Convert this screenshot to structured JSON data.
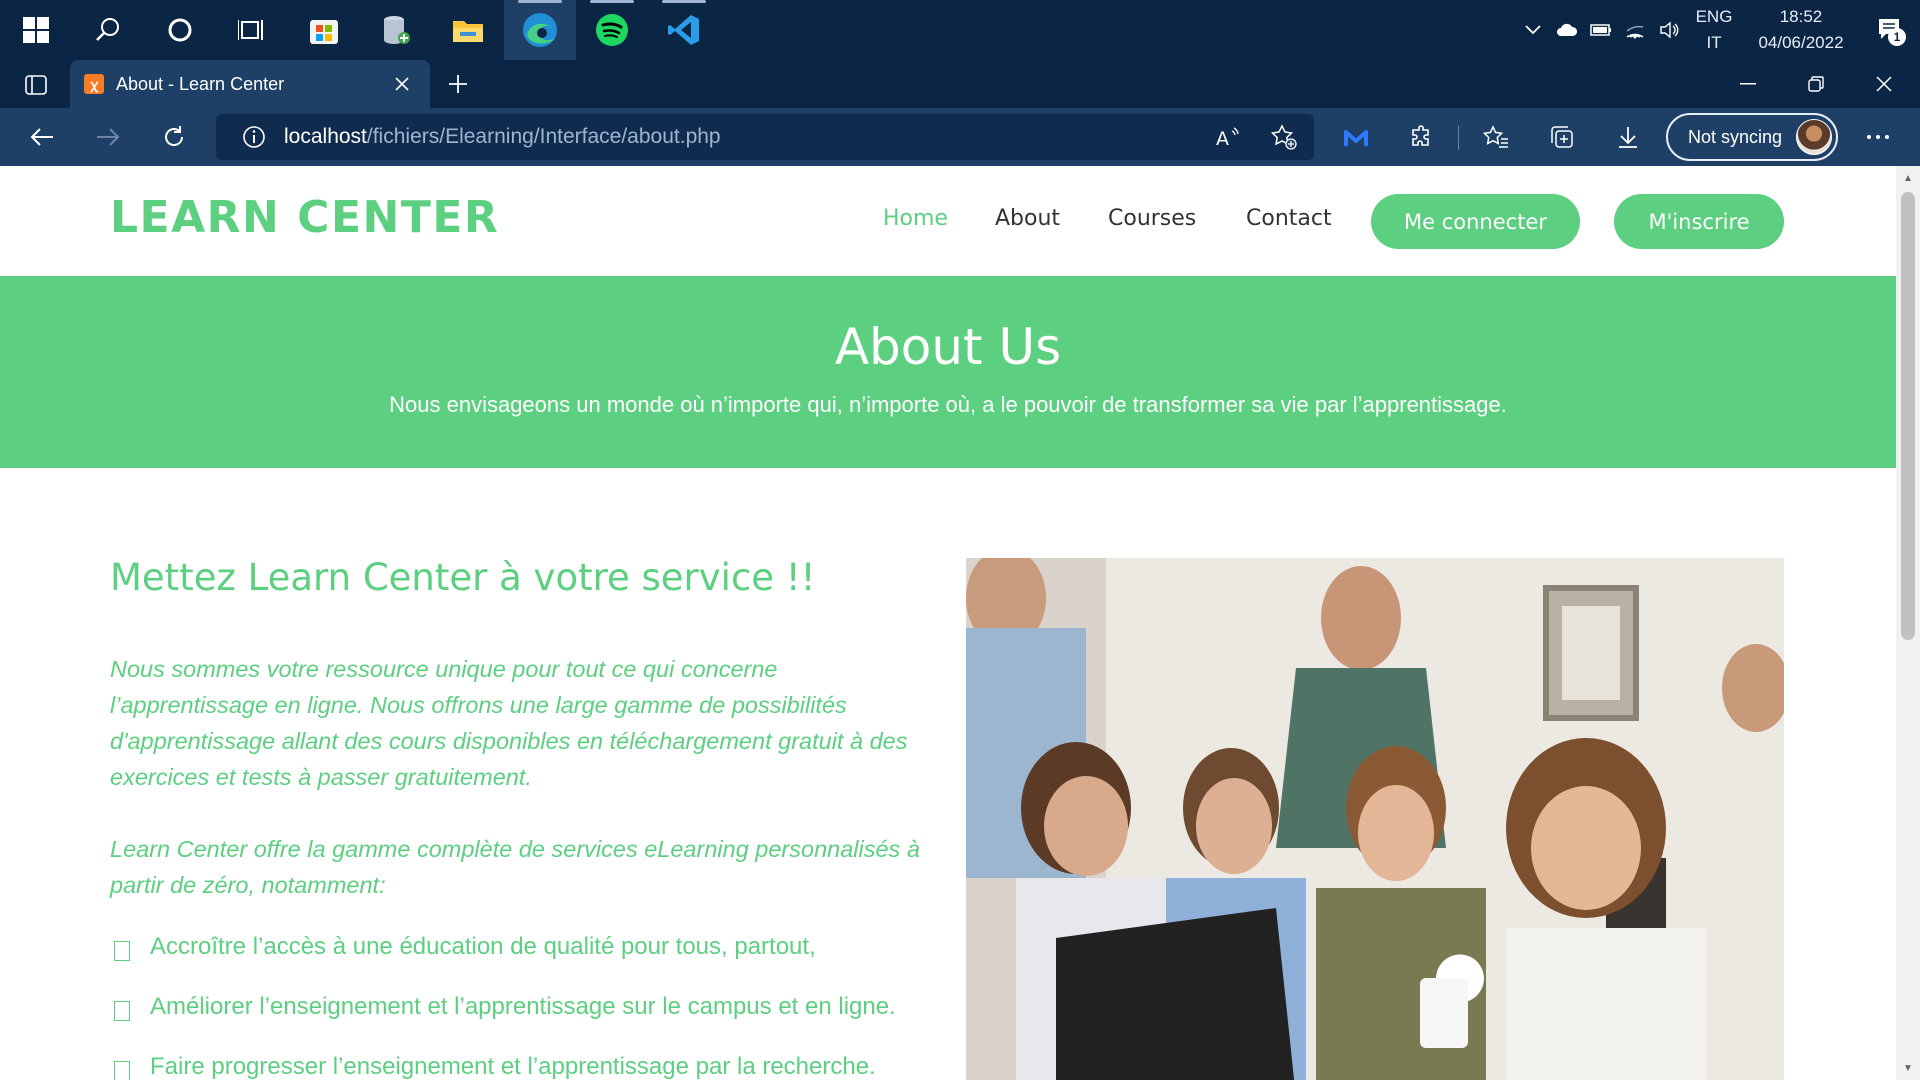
{
  "taskbar": {
    "apps": [
      "windows-start",
      "search",
      "cortana",
      "task-view",
      "microsoft-store",
      "database-app",
      "file-explorer",
      "edge",
      "spotify",
      "vscode"
    ],
    "language_top": "ENG",
    "language_bottom": "IT",
    "time": "18:52",
    "date": "04/06/2022",
    "notifications": "1"
  },
  "browser": {
    "tab_title": "About - Learn Center",
    "url_host": "localhost",
    "url_path": "/fichiers/Elearning/Interface/about.php",
    "sync_label": "Not syncing"
  },
  "site": {
    "logo": "LEARN CENTER",
    "nav": {
      "home": "Home",
      "about": "About",
      "courses": "Courses",
      "contact": "Contact",
      "login": "Me connecter",
      "signup": "M'inscrire"
    },
    "hero": {
      "title": "About Us",
      "subtitle": "Nous envisageons un monde où n’importe qui, n’importe où, a le pouvoir de transformer sa vie par l’apprentissage."
    },
    "content": {
      "title": "Mettez Learn Center à votre service !!",
      "para1": "Nous sommes votre ressource unique pour tout ce qui concerne l’apprentissage en ligne. Nous offrons une large gamme de possibilités d'apprentissage allant des cours disponibles en téléchargement gratuit à des exercices et tests à passer gratuitement.",
      "para2": "Learn Center offre la gamme complète de services eLearning personnalisés à partir de zéro, notamment:",
      "items": [
        "Accroître l’accès à une éducation de qualité pour tous, partout,",
        "Améliorer l’enseignement et l’apprentissage sur le campus et en ligne.",
        "Faire progresser l’enseignement et l’apprentissage par la recherche."
      ]
    }
  },
  "colors": {
    "brand_green": "#5ccf80",
    "taskbar_bg": "#0b2545",
    "toolbar_bg": "#1e3f66"
  }
}
